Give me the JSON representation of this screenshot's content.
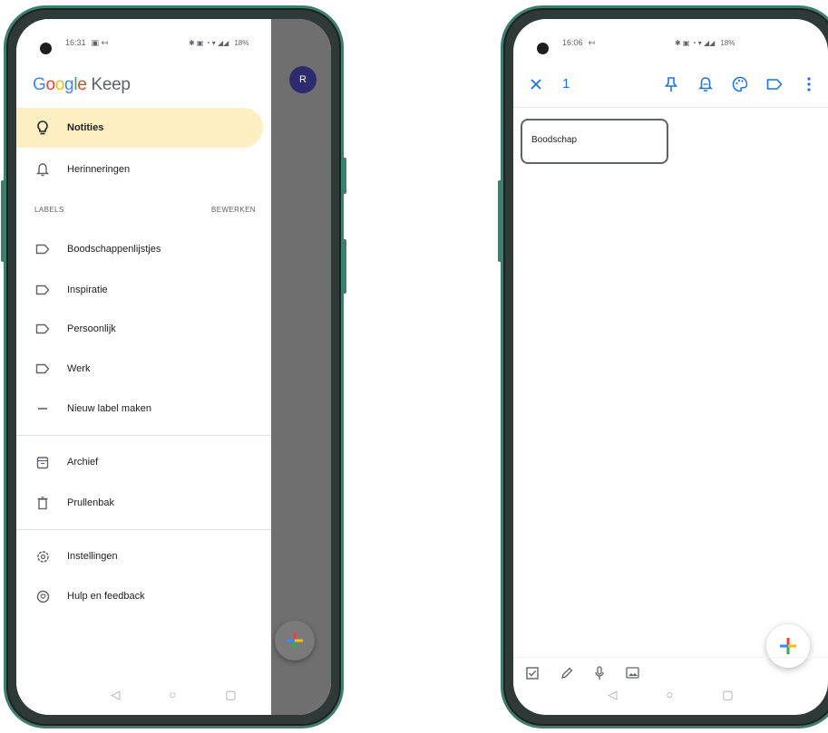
{
  "left_phone": {
    "status": {
      "time": "16:31",
      "battery": "18%"
    },
    "avatar_initial": "R",
    "app_title": {
      "google": [
        "G",
        "o",
        "o",
        "g",
        "l",
        "e"
      ],
      "keep": "Keep"
    },
    "nav": {
      "notes": "Notities",
      "reminders": "Herinneringen"
    },
    "labels_header": "LABELS",
    "labels_edit": "BEWERKEN",
    "labels": [
      "Boodschappenlijstjes",
      "Inspiratie",
      "Persoonlijk",
      "Werk"
    ],
    "new_label": "Nieuw label maken",
    "archive": "Archief",
    "trash": "Prullenbak",
    "settings": "Instellingen",
    "help": "Hulp en feedback"
  },
  "right_phone": {
    "status": {
      "time": "16:06",
      "battery": "18%"
    },
    "selected_count": "1",
    "note_title": "Boodschap"
  },
  "colors": {
    "frame": "#3f7d6e",
    "active_bg": "#feefc3",
    "accent": "#1a73e8",
    "scrim": "#6f6f6f"
  }
}
